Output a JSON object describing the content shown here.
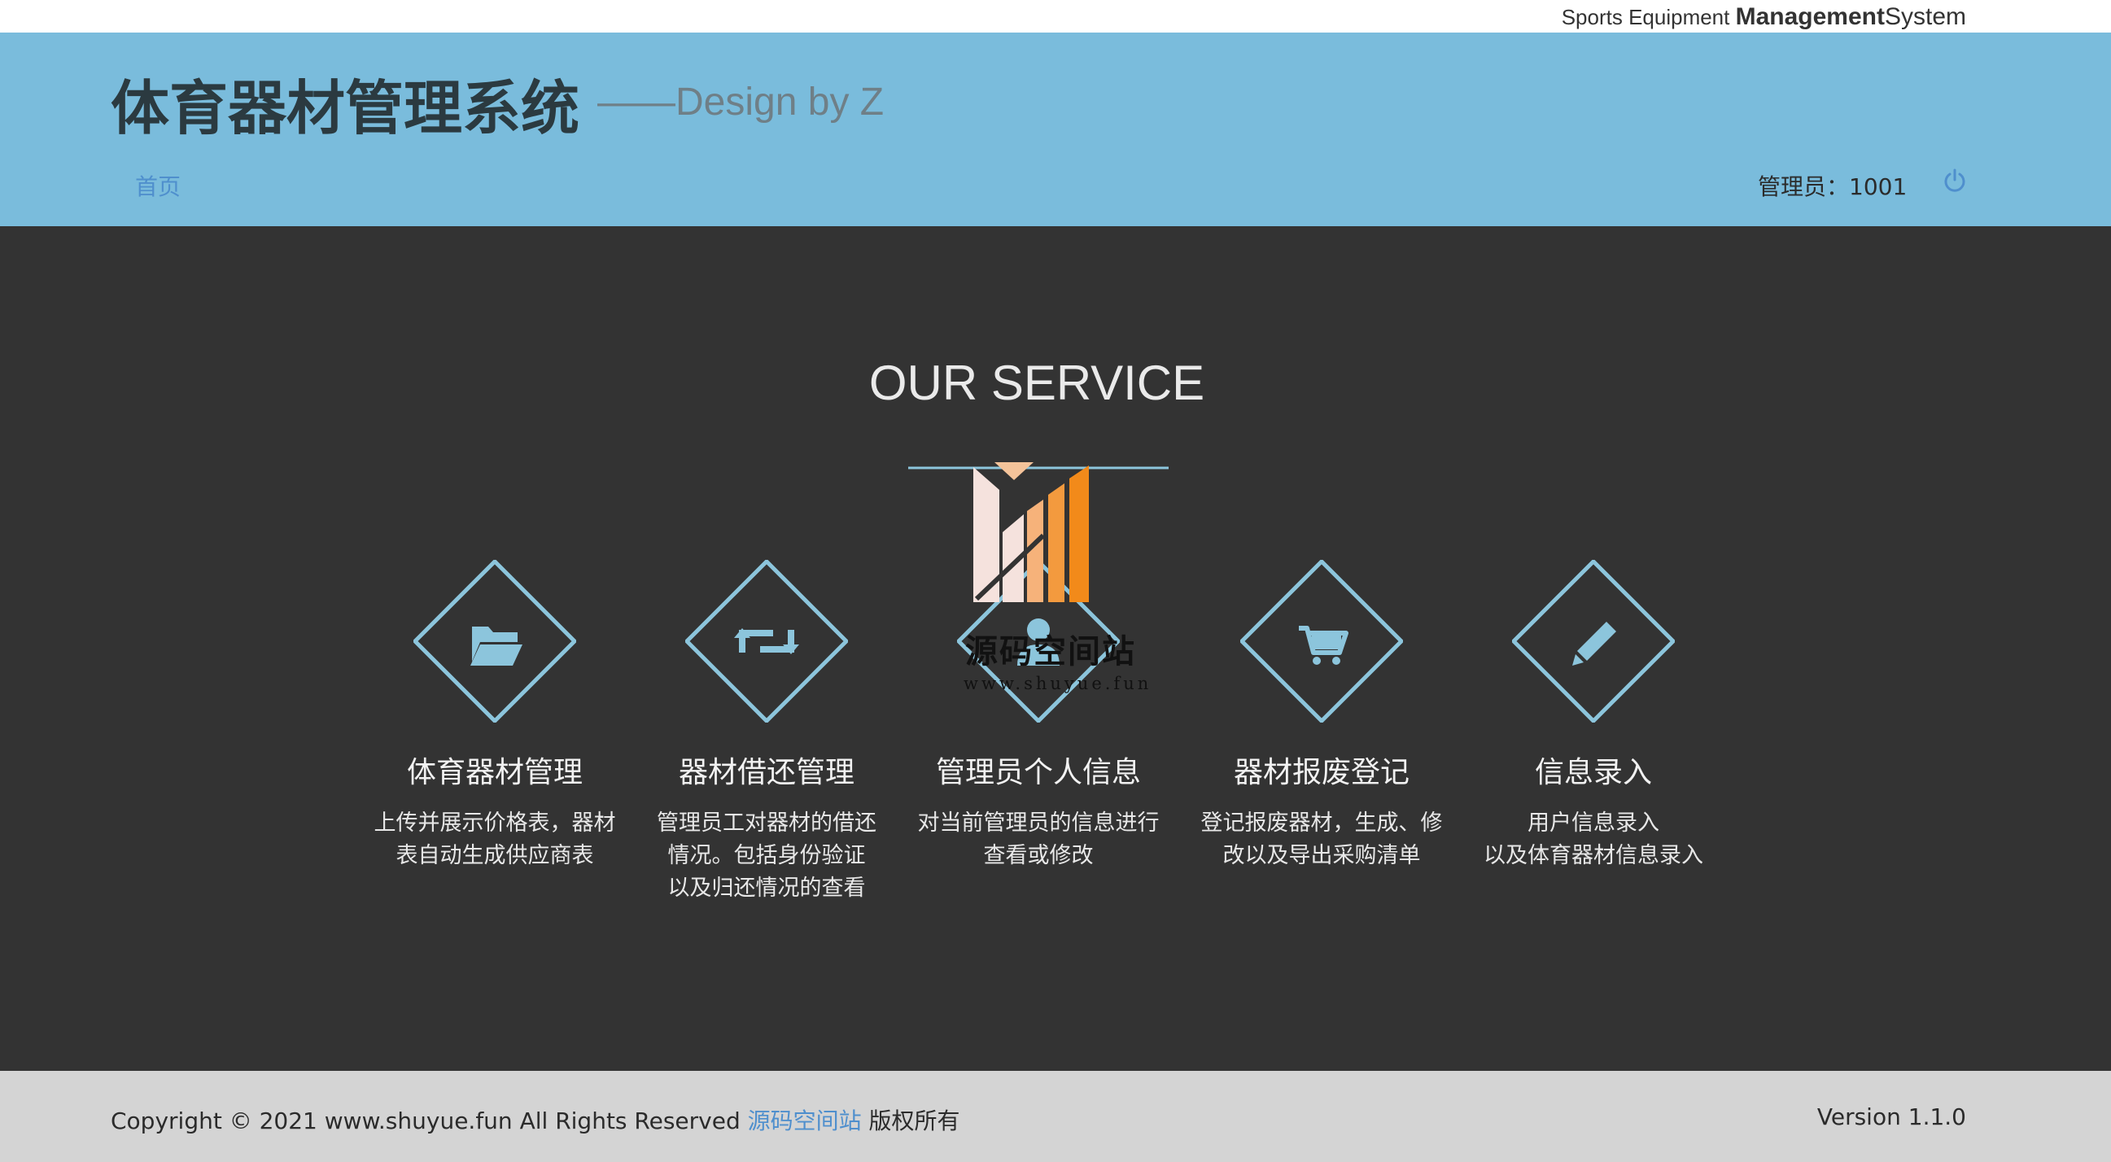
{
  "topbar": {
    "brand_prefix": "Sports Equipment ",
    "brand_strong": "Management",
    "brand_suffix": "System"
  },
  "header": {
    "title": "体育器材管理系统",
    "subtitle": "——Design by Z",
    "nav_home": "首页",
    "admin_label": "管理员：",
    "admin_id": "1001"
  },
  "main": {
    "heading": "OUR SERVICE",
    "services": [
      {
        "icon": "folder-open-icon",
        "name": "体育器材管理",
        "desc_lines": [
          "上传并展示价格表，器材",
          "表自动生成供应商表"
        ]
      },
      {
        "icon": "retweet-icon",
        "name": "器材借还管理",
        "desc_lines": [
          "管理员工对器材的借还",
          "情况。包括身份验证",
          "以及归还情况的查看"
        ]
      },
      {
        "icon": "user-icon",
        "name": "管理员个人信息",
        "desc_lines": [
          "对当前管理员的信息进行",
          "查看或修改"
        ]
      },
      {
        "icon": "shopping-cart-icon",
        "name": "器材报废登记",
        "desc_lines": [
          "登记报废器材，生成、修",
          "改以及导出采购清单"
        ]
      },
      {
        "icon": "pencil-icon",
        "name": "信息录入",
        "desc_lines": [
          "用户信息录入",
          "以及体育器材信息录入"
        ]
      }
    ]
  },
  "watermark": {
    "cn": "源码空间站",
    "url": "www.shuyue.fun"
  },
  "footer": {
    "copyright": "Copyright © 2021 www.shuyue.fun All Rights Reserved ",
    "site_name": "源码空间站",
    "rights": " 版权所有",
    "version_label": "Version ",
    "version_value": "1.1.0"
  },
  "colors": {
    "header_bg": "#7abcdc",
    "main_bg": "#333333",
    "footer_bg": "#d4d4d4",
    "accent_blue": "#4f8fcd",
    "icon_blue": "#8cc5dc",
    "watermark_orange": "#f28a1a"
  }
}
